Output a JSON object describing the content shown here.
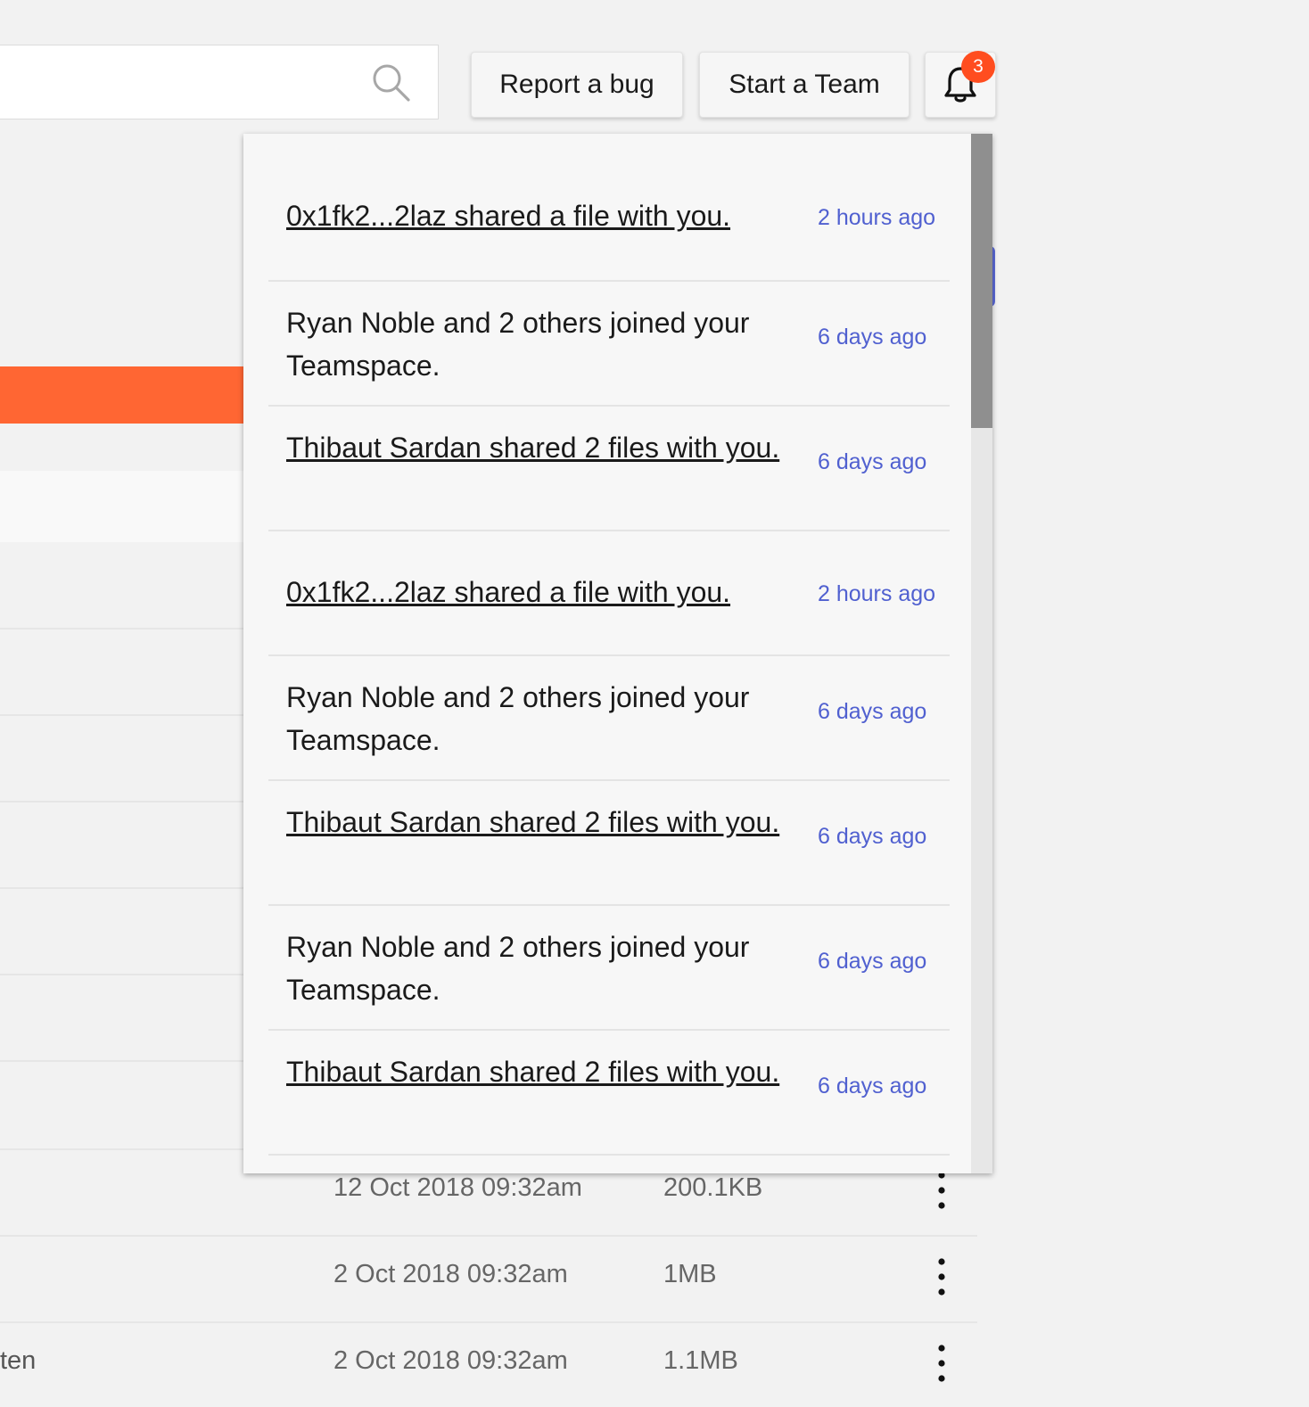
{
  "search": {
    "value": "",
    "placeholder": ""
  },
  "header": {
    "report_bug_label": "Report a bug",
    "start_team_label": "Start a Team",
    "notification_count": "3"
  },
  "notifications": [
    {
      "message": "0x1fk2...2laz shared a file with you.",
      "time": "2 hours ago",
      "link": true
    },
    {
      "message": "Ryan Noble and 2 others  joined your Teamspace.",
      "time": "6 days ago",
      "link": false
    },
    {
      "message": "Thibaut Sardan shared 2 files with you.",
      "time": "6 days ago",
      "link": true
    },
    {
      "message": "0x1fk2...2laz shared a file with you.",
      "time": "2 hours ago",
      "link": true
    },
    {
      "message": "Ryan Noble and 2 others  joined your Teamspace.",
      "time": "6 days ago",
      "link": false
    },
    {
      "message": "Thibaut Sardan shared 2 files with you.",
      "time": "6 days ago",
      "link": true
    },
    {
      "message": "Ryan Noble and 2 others  joined your Teamspace.",
      "time": "6 days ago",
      "link": false
    },
    {
      "message": "Thibaut Sardan shared 2 files with you.",
      "time": "6 days ago",
      "link": true
    }
  ],
  "files": [
    {
      "name": "",
      "date": "12 Oct 2018 09:32am",
      "size": "200.1KB"
    },
    {
      "name": "",
      "date": "2 Oct 2018 09:32am",
      "size": "1MB"
    },
    {
      "name": "ten",
      "date": "2 Oct 2018 09:32am",
      "size": "1.1MB"
    }
  ],
  "icons": {
    "search": "search-icon",
    "bell": "bell-icon",
    "more": "more-vertical-icon"
  },
  "colors": {
    "accent": "#ff6633",
    "badge": "#ff4d1f",
    "time_text": "#5060d0",
    "tab_indicator": "#5b69d6"
  }
}
